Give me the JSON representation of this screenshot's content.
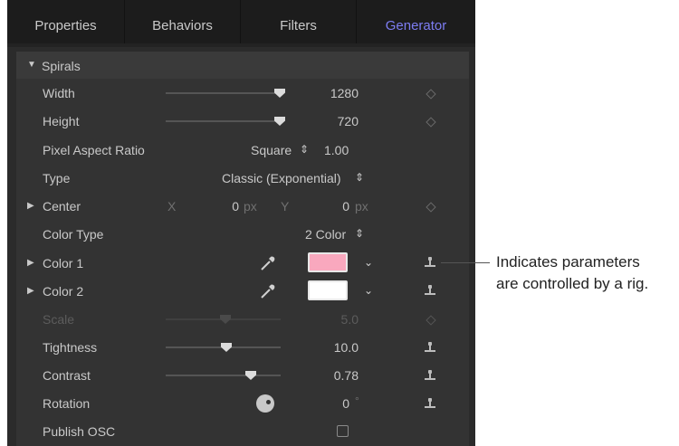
{
  "tabs": [
    {
      "label": "Properties"
    },
    {
      "label": "Behaviors"
    },
    {
      "label": "Filters"
    },
    {
      "label": "Generator",
      "active": true
    }
  ],
  "group": {
    "label": "Spirals",
    "expanded": true
  },
  "rows": {
    "width": {
      "label": "Width",
      "value": "1280",
      "slider_fraction": 0.97
    },
    "height": {
      "label": "Height",
      "value": "720",
      "slider_fraction": 0.97
    },
    "pixel_aspect": {
      "label": "Pixel Aspect Ratio",
      "select": "Square",
      "value": "1.00"
    },
    "type": {
      "label": "Type",
      "select": "Classic (Exponential)"
    },
    "center": {
      "label": "Center",
      "x_label": "X",
      "x_value": "0",
      "x_unit": "px",
      "y_label": "Y",
      "y_value": "0",
      "y_unit": "px"
    },
    "color_type": {
      "label": "Color Type",
      "select": "2 Color"
    },
    "color1": {
      "label": "Color 1",
      "color": "#f9a8be"
    },
    "color2": {
      "label": "Color 2",
      "color": "#ffffff"
    },
    "scale": {
      "label": "Scale",
      "value": "5.0",
      "disabled": true,
      "slider_fraction": 0.52
    },
    "tightness": {
      "label": "Tightness",
      "value": "10.0",
      "slider_fraction": 0.52
    },
    "contrast": {
      "label": "Contrast",
      "value": "0.78",
      "slider_fraction": 0.75
    },
    "rotation": {
      "label": "Rotation",
      "value": "0",
      "unit": "°"
    },
    "publish_osc": {
      "label": "Publish OSC",
      "checked": false
    }
  },
  "icons": {
    "stepper": "⇕",
    "chevron": "chevron-down-icon",
    "eyedropper": "eyedropper-icon",
    "rig": "rig-icon",
    "keyframe": "keyframe-icon"
  },
  "callout": {
    "line1": "Indicates parameters",
    "line2": "are controlled by a rig."
  },
  "colors": {
    "accent": "#7d7df2",
    "panel": "#2b2b2b",
    "content": "#333333"
  }
}
